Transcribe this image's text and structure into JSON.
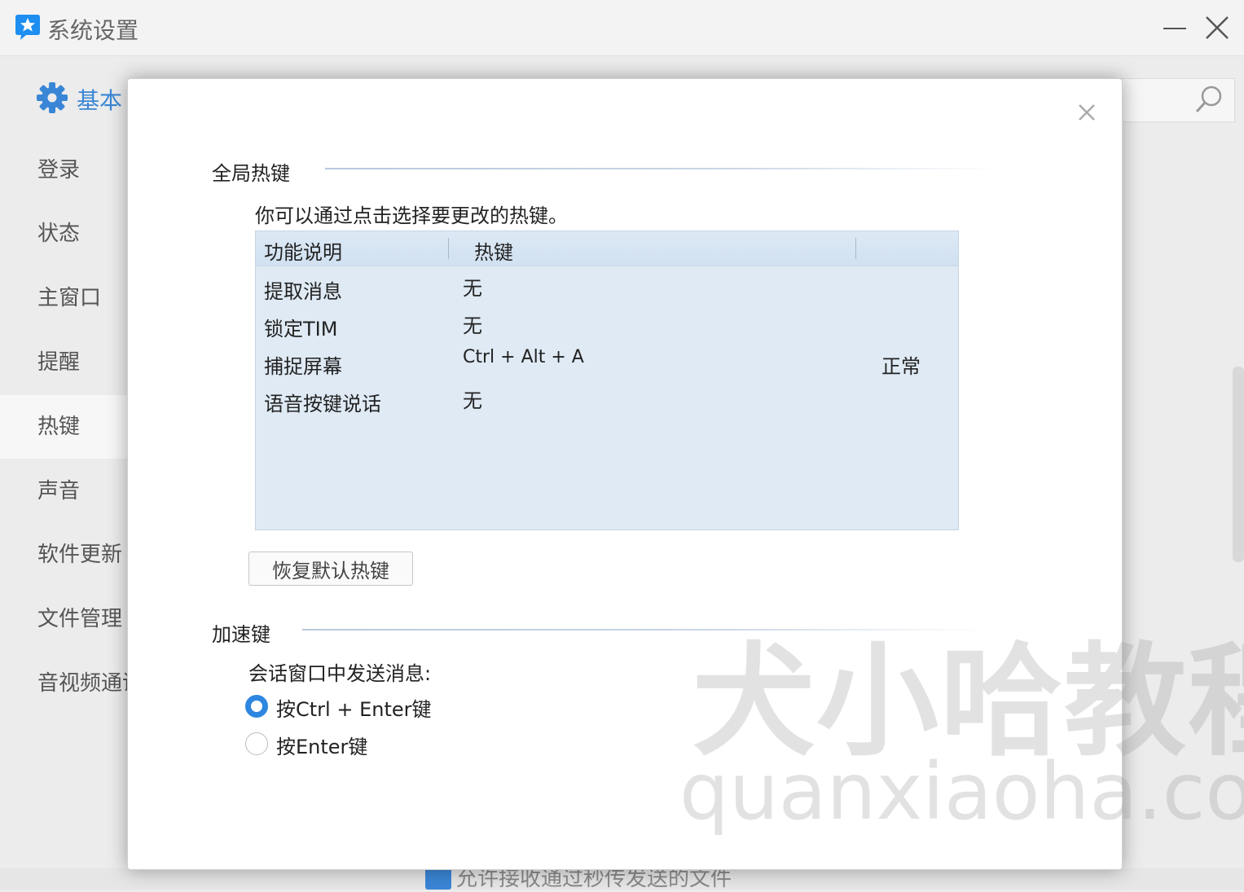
{
  "window": {
    "title": "系统设置",
    "brand_color": "#1e8ef0"
  },
  "header": {
    "basic_tab": "基本"
  },
  "sidebar": {
    "items": [
      {
        "label": "登录"
      },
      {
        "label": "状态"
      },
      {
        "label": "主窗口"
      },
      {
        "label": "提醒"
      },
      {
        "label": "热键",
        "active": true
      },
      {
        "label": "声音"
      },
      {
        "label": "软件更新"
      },
      {
        "label": "文件管理"
      },
      {
        "label": "音视频通话"
      }
    ]
  },
  "background": {
    "checkbox_text": "允许接收通过秒传发送的文件"
  },
  "dialog": {
    "global_hotkeys": {
      "title": "全局热键",
      "hint": "你可以通过点击选择要更改的热键。",
      "columns": [
        "功能说明",
        "热键"
      ],
      "rows": [
        {
          "function": "提取消息",
          "hotkey": "无",
          "status": ""
        },
        {
          "function": "锁定TIM",
          "hotkey": "无",
          "status": ""
        },
        {
          "function": "捕捉屏幕",
          "hotkey": "Ctrl + Alt + A",
          "status": "正常"
        },
        {
          "function": "语音按键说话",
          "hotkey": "无",
          "status": ""
        }
      ],
      "reset_button": "恢复默认热键"
    },
    "accelerators": {
      "title": "加速键",
      "send_label": "会话窗口中发送消息:",
      "options": [
        {
          "label": "按Ctrl + Enter键",
          "selected": true
        },
        {
          "label": "按Enter键",
          "selected": false
        }
      ]
    }
  },
  "watermark": {
    "cn": "犬小哈教程",
    "en": "quanxiaoha.com"
  },
  "colors": {
    "accent": "#2f86e0",
    "table_bg": "#dfeaf4"
  }
}
